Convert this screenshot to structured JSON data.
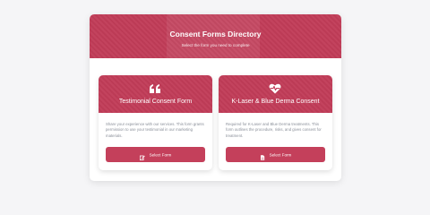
{
  "directory": {
    "title": "Consent Forms Directory",
    "subtitle": "Select the form you need to complete"
  },
  "forms": [
    {
      "icon": "quote-icon",
      "title": "Testimonial Consent Form",
      "description": "Share your experience with our services. This form grants permission to use your testimonial in our marketing materials.",
      "button_icon": "pen-icon",
      "button_label": "Select Form"
    },
    {
      "icon": "heartbeat-icon",
      "title": "K-Laser & Blue Derma Consent",
      "description": "Required for K-Laser and Blue Derma treatments. This form outlines the procedure, risks, and gives consent for treatment.",
      "button_icon": "document-icon",
      "button_label": "Select Form"
    }
  ],
  "colors": {
    "accent": "#c13c58",
    "background": "#f5f5f7",
    "text_muted": "#8a8f99"
  }
}
